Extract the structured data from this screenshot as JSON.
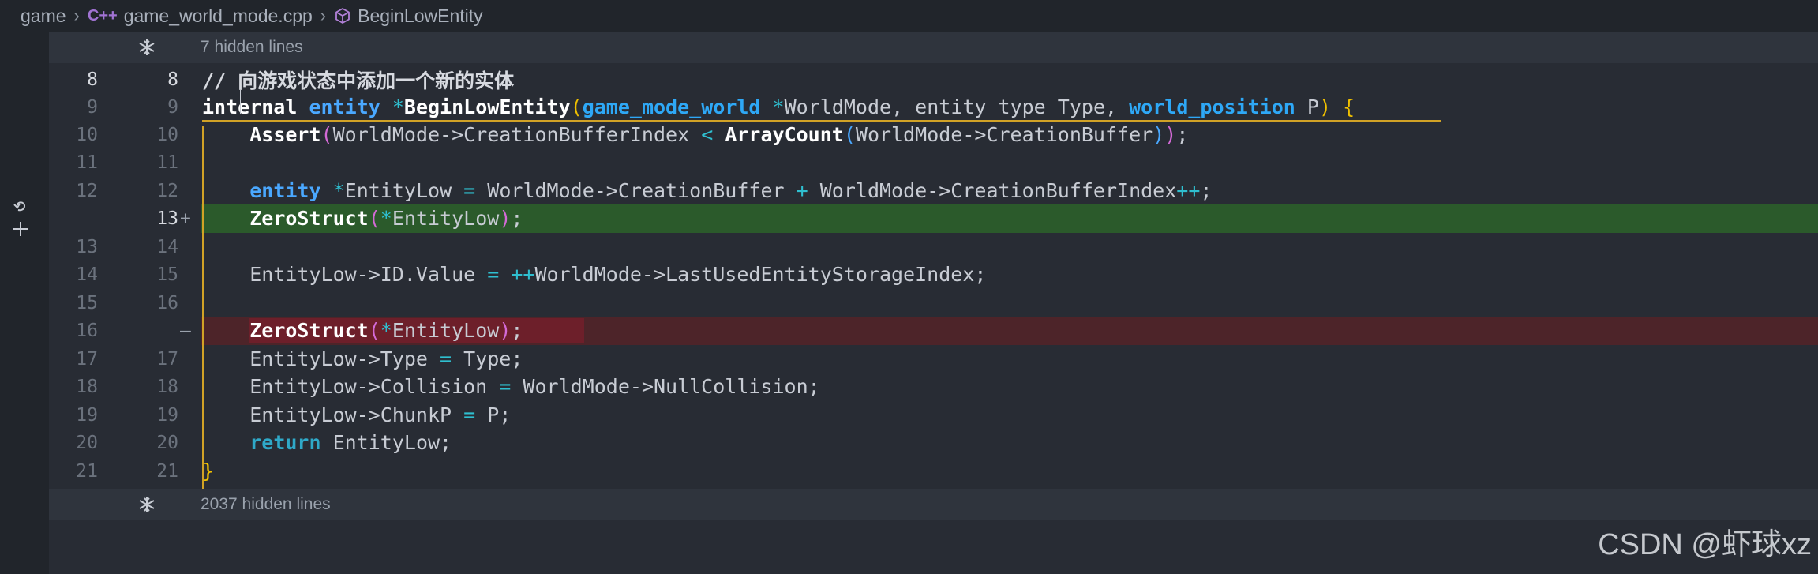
{
  "breadcrumb": {
    "items": [
      "game",
      "game_world_mode.cpp",
      "BeginLowEntity"
    ],
    "file_icon_text": "C++"
  },
  "hidden": {
    "top": "7 hidden lines",
    "bottom": "2037 hidden lines"
  },
  "lines": [
    {
      "old": "8",
      "new": "8",
      "sign": "",
      "code": "// 向游戏状态中添加一个新的实体"
    },
    {
      "old": "9",
      "new": "9",
      "sign": "",
      "code": "internal entity *BeginLowEntity(game_mode_world *WorldMode, entity_type Type, world_position P) {"
    },
    {
      "old": "10",
      "new": "10",
      "sign": "",
      "code": "    Assert(WorldMode->CreationBufferIndex < ArrayCount(WorldMode->CreationBuffer));"
    },
    {
      "old": "11",
      "new": "11",
      "sign": "",
      "code": ""
    },
    {
      "old": "12",
      "new": "12",
      "sign": "",
      "code": "    entity *EntityLow = WorldMode->CreationBuffer + WorldMode->CreationBufferIndex++;"
    },
    {
      "old": "",
      "new": "13",
      "sign": "+",
      "code": "    ZeroStruct(*EntityLow);"
    },
    {
      "old": "13",
      "new": "14",
      "sign": "",
      "code": ""
    },
    {
      "old": "14",
      "new": "15",
      "sign": "",
      "code": "    EntityLow->ID.Value = ++WorldMode->LastUsedEntityStorageIndex;"
    },
    {
      "old": "15",
      "new": "16",
      "sign": "",
      "code": ""
    },
    {
      "old": "16",
      "new": "",
      "sign": "—",
      "code": "    ZeroStruct(*EntityLow);"
    },
    {
      "old": "17",
      "new": "17",
      "sign": "",
      "code": "    EntityLow->Type = Type;"
    },
    {
      "old": "18",
      "new": "18",
      "sign": "",
      "code": "    EntityLow->Collision = WorldMode->NullCollision;"
    },
    {
      "old": "19",
      "new": "19",
      "sign": "",
      "code": "    EntityLow->ChunkP = P;"
    },
    {
      "old": "20",
      "new": "20",
      "sign": "",
      "code": "    return EntityLow;"
    },
    {
      "old": "21",
      "new": "21",
      "sign": "",
      "code": "}"
    }
  ],
  "watermark": "CSDN @虾球xz",
  "colors": {
    "added_bg": "#2b5a2b",
    "removed_bg": "#4d2429",
    "keyword": "#4aa8ff",
    "scope_line": "#d1a226"
  }
}
